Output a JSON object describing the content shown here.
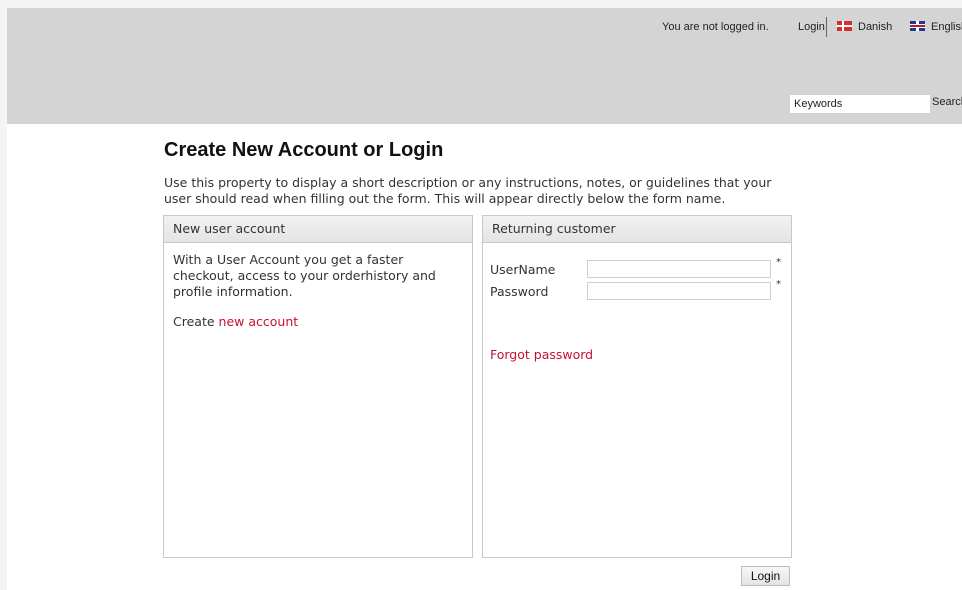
{
  "topbar": {
    "status": "You are not logged in.",
    "login": "Login",
    "languages": [
      "Danish",
      "English"
    ]
  },
  "search": {
    "placeholder": "Keywords",
    "button": "Search"
  },
  "page": {
    "title": "Create New Account or Login",
    "description": "Use this property to display a short description or any instructions, notes, or guidelines that your user should read when filling out the form. This will appear directly below the form name."
  },
  "new_account": {
    "heading": "New user account",
    "text": "With a User Account you get a faster checkout, access to your orderhistory and profile information.",
    "create_prefix": "Create",
    "create_link": "new account"
  },
  "returning": {
    "heading": "Returning customer",
    "username_label": "UserName",
    "password_label": "Password",
    "required_mark": "*",
    "forgot": "Forgot password"
  },
  "actions": {
    "login_button": "Login"
  },
  "colors": {
    "header_bg": "#d4d4d4",
    "link_red": "#c8102e"
  },
  "icons": [
    "denmark-flag-icon",
    "uk-flag-icon"
  ]
}
